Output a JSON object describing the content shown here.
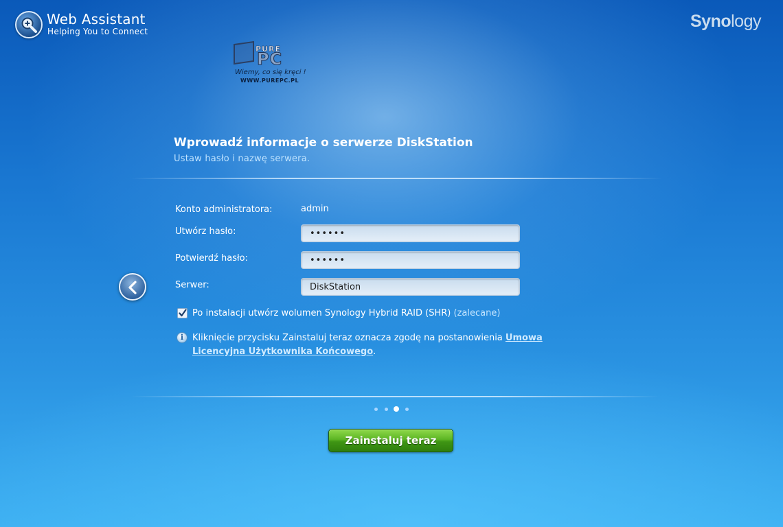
{
  "header": {
    "app_title": "Web Assistant",
    "app_subtitle": "Helping You to Connect",
    "brand_bold": "Syno",
    "brand_light": "logy"
  },
  "watermark": {
    "brand_top": "PURE",
    "brand_main": "PC",
    "tagline": "Wiemy, co się kręci !",
    "url": "WWW.PUREPC.PL"
  },
  "panel": {
    "title": "Wprowadź informacje o serwerze DiskStation",
    "subtitle": "Ustaw hasło i nazwę serwera."
  },
  "form": {
    "admin_label": "Konto administratora:",
    "admin_value": "admin",
    "password_label": "Utwórz hasło:",
    "password_value": "••••••",
    "confirm_label": "Potwierdź hasło:",
    "confirm_value": "••••••",
    "server_label": "Serwer:",
    "server_value": "DiskStation",
    "shr_checkbox_label": "Po instalacji utwórz wolumen Synology Hybrid RAID (SHR)",
    "shr_checkbox_hint": "(zalecane)",
    "shr_checked": true
  },
  "notice": {
    "text": "Kliknięcie przycisku Zainstaluj teraz oznacza zgodę na postanowienia ",
    "link_text": "Umowa Licencyjna Użytkownika Końcowego",
    "suffix": "."
  },
  "pager": {
    "total": 4,
    "active_index": 2
  },
  "actions": {
    "install_label": "Zainstaluj teraz"
  },
  "colors": {
    "install_button": "#4caf1c",
    "link": "#cfeaff",
    "background_top": "#0a59b9",
    "background_bottom": "#3db0f2"
  }
}
